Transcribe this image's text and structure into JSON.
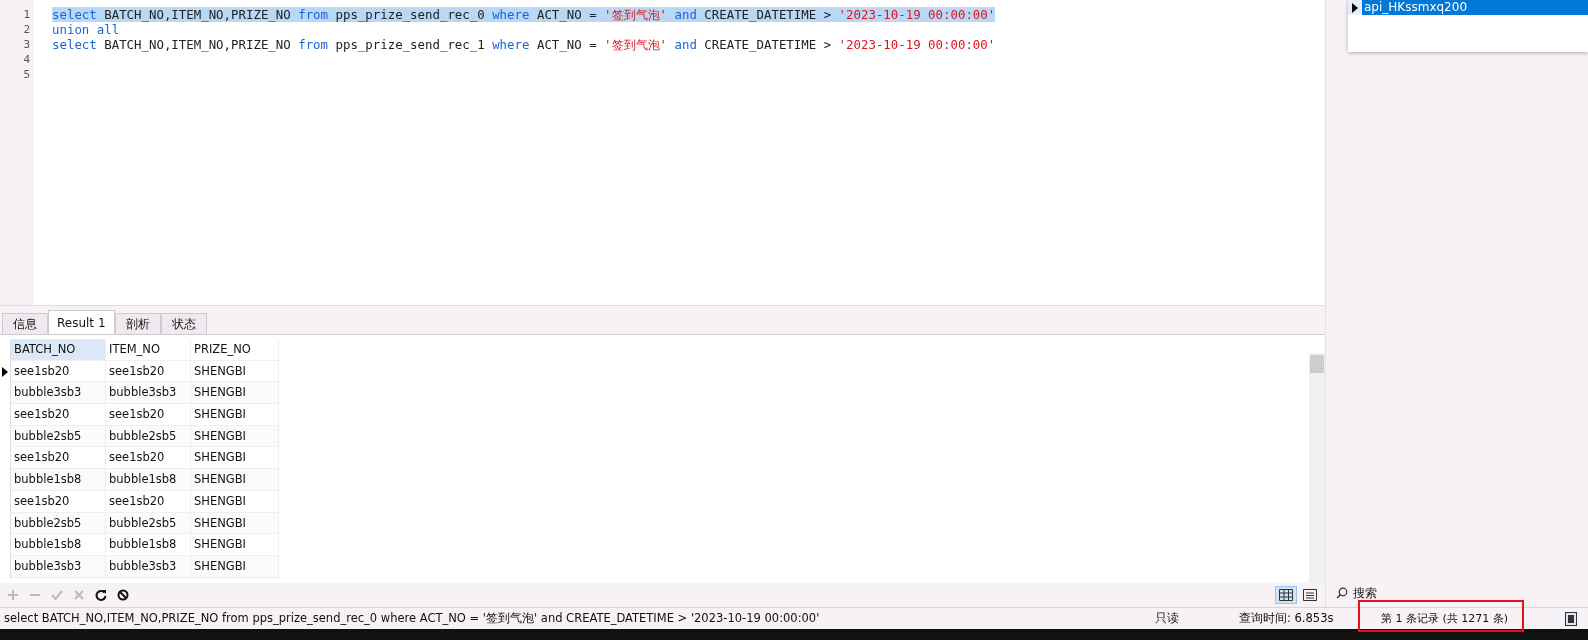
{
  "editor": {
    "lines": [
      {
        "number": "1",
        "selected": true,
        "tokens": [
          {
            "kind": "keyword",
            "text": "select"
          },
          {
            "kind": "plain",
            "text": " BATCH_NO,ITEM_NO,PRIZE_NO "
          },
          {
            "kind": "keyword",
            "text": "from"
          },
          {
            "kind": "plain",
            "text": " pps_prize_send_rec_0 "
          },
          {
            "kind": "keyword",
            "text": "where"
          },
          {
            "kind": "plain",
            "text": " ACT_NO = "
          },
          {
            "kind": "string",
            "text": "'签到气泡'"
          },
          {
            "kind": "keyword",
            "text": " and"
          },
          {
            "kind": "plain",
            "text": " CREATE_DATETIME > "
          },
          {
            "kind": "string",
            "text": "'2023-10-19 00:00:00'"
          }
        ]
      },
      {
        "number": "2",
        "selected": false,
        "tokens": [
          {
            "kind": "keyword",
            "text": "union all"
          }
        ]
      },
      {
        "number": "3",
        "selected": false,
        "tokens": [
          {
            "kind": "keyword",
            "text": "select"
          },
          {
            "kind": "plain",
            "text": " BATCH_NO,ITEM_NO,PRIZE_NO "
          },
          {
            "kind": "keyword",
            "text": "from"
          },
          {
            "kind": "plain",
            "text": " pps_prize_send_rec_1 "
          },
          {
            "kind": "keyword",
            "text": "where"
          },
          {
            "kind": "plain",
            "text": " ACT_NO = "
          },
          {
            "kind": "string",
            "text": "'签到气泡'"
          },
          {
            "kind": "keyword",
            "text": " and"
          },
          {
            "kind": "plain",
            "text": " CREATE_DATETIME > "
          },
          {
            "kind": "string",
            "text": "'2023-10-19 00:00:00'"
          }
        ]
      },
      {
        "number": "4"
      },
      {
        "number": "5"
      }
    ]
  },
  "dropdown": {
    "items": [
      {
        "label": "api_HKssmxq200",
        "selected": true
      }
    ]
  },
  "tabs": [
    {
      "label": "信息",
      "selected": false
    },
    {
      "label": "Result 1",
      "selected": true
    },
    {
      "label": "剖析",
      "selected": false
    },
    {
      "label": "状态",
      "selected": false
    }
  ],
  "table": {
    "columns": [
      "BATCH_NO",
      "ITEM_NO",
      "PRIZE_NO"
    ],
    "rows": [
      {
        "selected": true,
        "cells": [
          "see1sb20",
          "see1sb20",
          "SHENGBI"
        ]
      },
      {
        "selected": false,
        "cells": [
          "bubble3sb3",
          "bubble3sb3",
          "SHENGBI"
        ]
      },
      {
        "selected": false,
        "cells": [
          "see1sb20",
          "see1sb20",
          "SHENGBI"
        ]
      },
      {
        "selected": false,
        "cells": [
          "bubble2sb5",
          "bubble2sb5",
          "SHENGBI"
        ]
      },
      {
        "selected": false,
        "cells": [
          "see1sb20",
          "see1sb20",
          "SHENGBI"
        ]
      },
      {
        "selected": false,
        "cells": [
          "bubble1sb8",
          "bubble1sb8",
          "SHENGBI"
        ]
      },
      {
        "selected": false,
        "cells": [
          "see1sb20",
          "see1sb20",
          "SHENGBI"
        ]
      },
      {
        "selected": false,
        "cells": [
          "bubble2sb5",
          "bubble2sb5",
          "SHENGBI"
        ]
      },
      {
        "selected": false,
        "cells": [
          "bubble1sb8",
          "bubble1sb8",
          "SHENGBI"
        ]
      },
      {
        "selected": false,
        "cells": [
          "bubble3sb3",
          "bubble3sb3",
          "SHENGBI"
        ]
      }
    ]
  },
  "toolbar": {
    "buttons": [
      {
        "kind": "add",
        "disabled": true
      },
      {
        "kind": "remove",
        "disabled": true
      },
      {
        "kind": "apply",
        "disabled": true
      },
      {
        "kind": "cancel",
        "disabled": true
      },
      {
        "kind": "refresh",
        "disabled": false
      },
      {
        "kind": "stop",
        "disabled": false
      }
    ]
  },
  "view_toggle": {
    "grid_selected": true
  },
  "search": {
    "placeholder": "搜索"
  },
  "status_bar": {
    "query": "select BATCH_NO,ITEM_NO,PRIZE_NO from pps_prize_send_rec_0 where ACT_NO = '签到气泡' and CREATE_DATETIME > '2023-10-19 00:00:00'",
    "mode": "只读",
    "query_time": "查询时间: 6.853s",
    "record": "第 1 条记录 (共 1271 条)"
  }
}
